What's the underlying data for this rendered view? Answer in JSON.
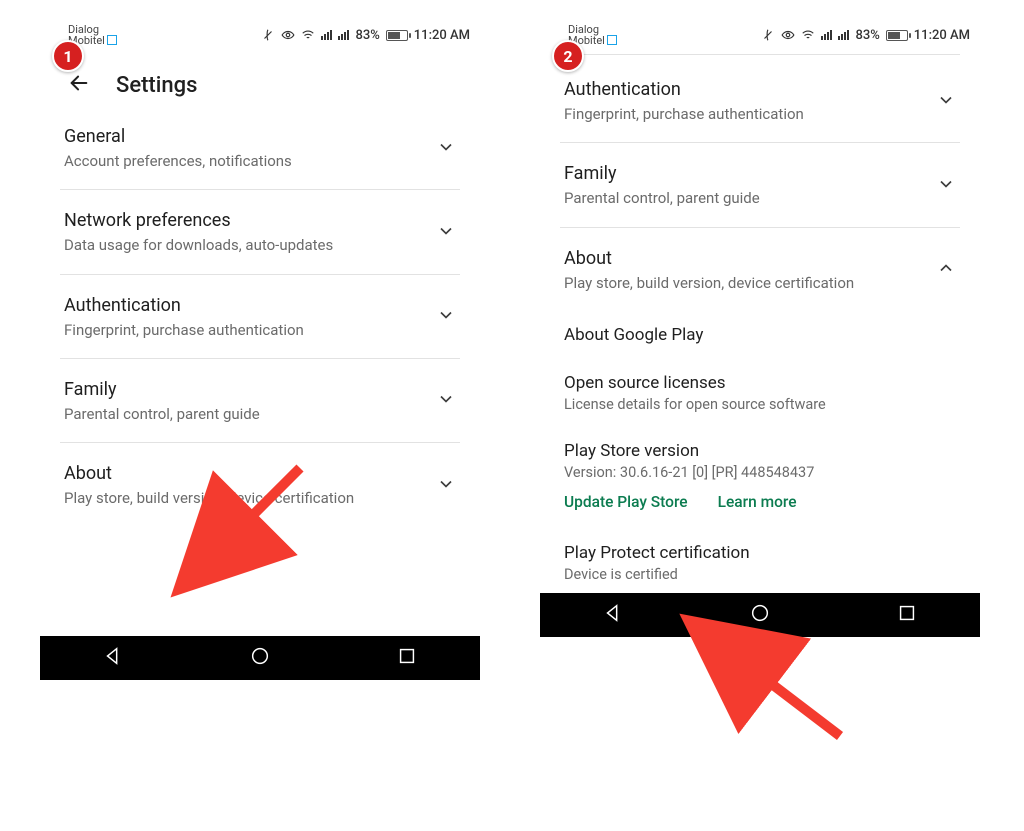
{
  "badges": {
    "one": "1",
    "two": "2"
  },
  "statusbar": {
    "carrier1": "Dialog",
    "carrier2": "Mobitel",
    "battery_pct": "83%",
    "time": "11:20 AM"
  },
  "screen1": {
    "title": "Settings",
    "rows": {
      "general": {
        "title": "General",
        "sub": "Account preferences, notifications"
      },
      "network": {
        "title": "Network preferences",
        "sub": "Data usage for downloads, auto-updates"
      },
      "auth": {
        "title": "Authentication",
        "sub": "Fingerprint, purchase authentication"
      },
      "family": {
        "title": "Family",
        "sub": "Parental control, parent guide"
      },
      "about": {
        "title": "About",
        "sub": "Play store, build version, device certification"
      }
    }
  },
  "screen2": {
    "rows": {
      "auth": {
        "title": "Authentication",
        "sub": "Fingerprint, purchase authentication"
      },
      "family": {
        "title": "Family",
        "sub": "Parental control, parent guide"
      },
      "about": {
        "title": "About",
        "sub": "Play store, build version, device certification"
      }
    },
    "about_section": {
      "heading": "About Google Play",
      "licenses_title": "Open source licenses",
      "licenses_sub": "License details for open source software",
      "version_title": "Play Store version",
      "version_sub": "Version: 30.6.16-21 [0] [PR] 448548437",
      "update_label": "Update Play Store",
      "learn_label": "Learn more",
      "protect_title": "Play Protect certification",
      "protect_sub": "Device is certified"
    }
  }
}
